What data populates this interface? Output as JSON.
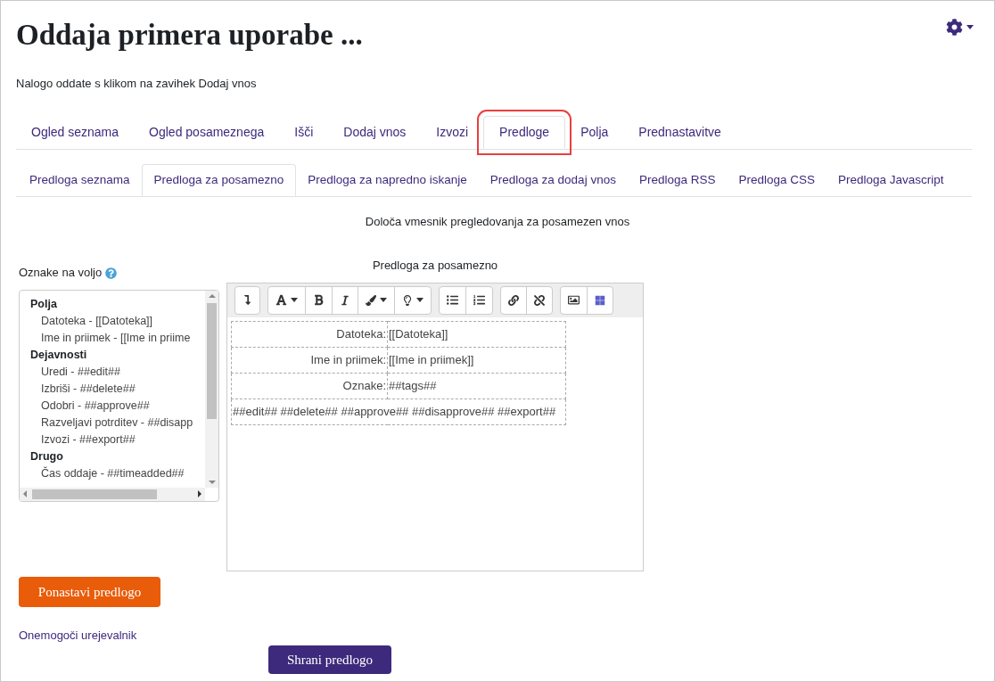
{
  "title": "Oddaja primera uporabe ...",
  "intro": "Nalogo oddate s klikom na zavihek Dodaj vnos",
  "tabs": [
    {
      "label": "Ogled seznama",
      "selected": false,
      "highlighted": false
    },
    {
      "label": "Ogled posameznega",
      "selected": false,
      "highlighted": false
    },
    {
      "label": "Išči",
      "selected": false,
      "highlighted": false
    },
    {
      "label": "Dodaj vnos",
      "selected": false,
      "highlighted": false
    },
    {
      "label": "Izvozi",
      "selected": false,
      "highlighted": false
    },
    {
      "label": "Predloge",
      "selected": true,
      "highlighted": true
    },
    {
      "label": "Polja",
      "selected": false,
      "highlighted": false
    },
    {
      "label": "Prednastavitve",
      "selected": false,
      "highlighted": false
    }
  ],
  "subtabs": [
    {
      "label": "Predloga seznama",
      "selected": false
    },
    {
      "label": "Predloga za posamezno",
      "selected": true
    },
    {
      "label": "Predloga za napredno iskanje",
      "selected": false
    },
    {
      "label": "Predloga za dodaj vnos",
      "selected": false
    },
    {
      "label": "Predloga RSS",
      "selected": false
    },
    {
      "label": "Predloga CSS",
      "selected": false
    },
    {
      "label": "Predloga Javascript",
      "selected": false
    }
  ],
  "description": "Določa vmesnik pregledovanja za posamezen vnos",
  "tags_label": "Oznake na voljo",
  "tag_groups": [
    {
      "heading": "Polja",
      "items": [
        "Datoteka - [[Datoteka]]",
        "Ime in priimek - [[Ime in priime"
      ]
    },
    {
      "heading": "Dejavnosti",
      "items": [
        "Uredi - ##edit##",
        "Izbriši - ##delete##",
        "Odobri - ##approve##",
        "Razveljavi potrditev - ##disapp",
        "Izvozi - ##export##"
      ]
    },
    {
      "heading": "Drugo",
      "items": [
        "Čas oddaje - ##timeadded##"
      ]
    }
  ],
  "editor_label": "Predloga za posamezno",
  "template_rows": [
    {
      "label": "Datoteka:",
      "value": "[[Datoteka]]"
    },
    {
      "label": "Ime in priimek:",
      "value": "[[Ime in priimek]]"
    },
    {
      "label": "Oznake:",
      "value": "##tags##"
    }
  ],
  "template_actions": "##edit## ##delete## ##approve## ##disapprove## ##export##",
  "reset_button": "Ponastavi predlogo",
  "disable_editor_link": "Onemogoči urejevalnik",
  "save_button": "Shrani predlogo"
}
